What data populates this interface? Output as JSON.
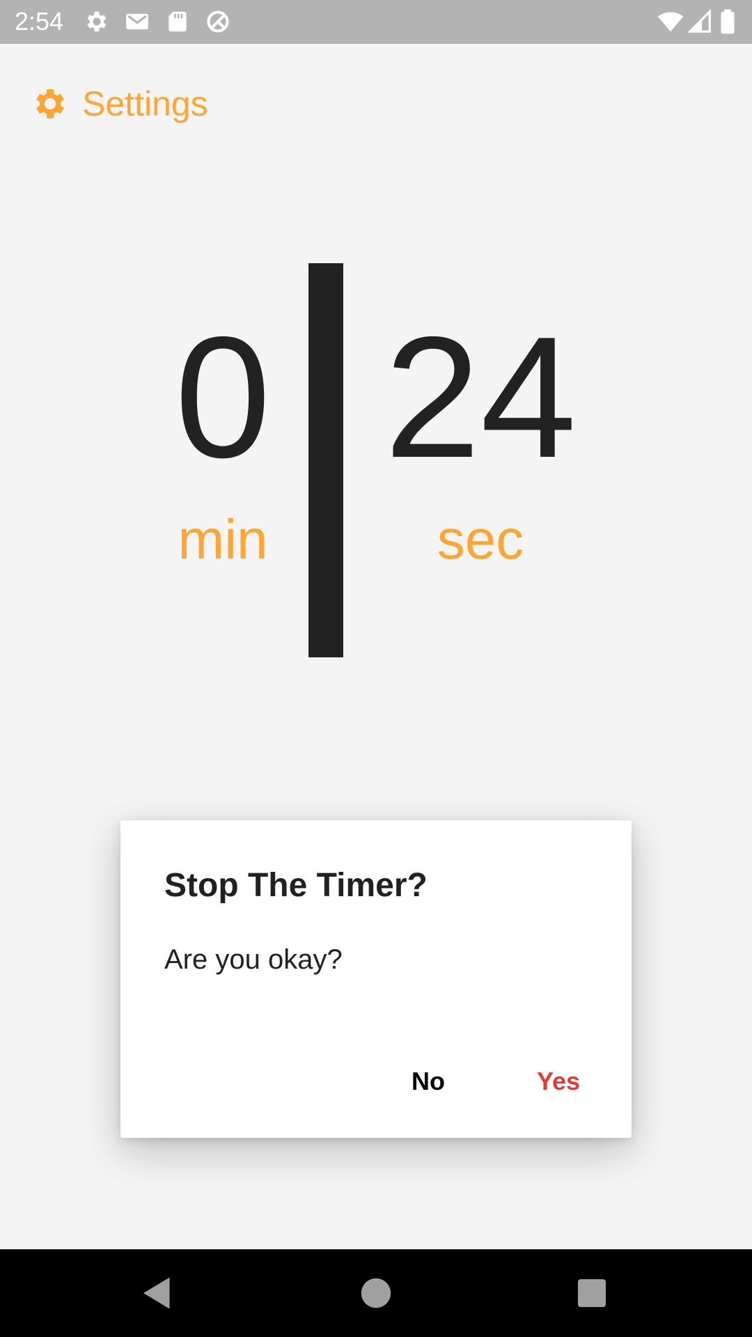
{
  "status_bar": {
    "time": "2:54",
    "icons_left": [
      "settings-icon",
      "gmail-icon",
      "sd-card-icon",
      "do-not-disturb-icon"
    ],
    "icons_right": [
      "wifi-icon",
      "cell-signal-icon",
      "battery-icon"
    ]
  },
  "header": {
    "settings_label": "Settings",
    "settings_icon": "gear-icon"
  },
  "timer": {
    "minutes": "0",
    "seconds": "24",
    "minutes_unit": "min",
    "seconds_unit": "sec"
  },
  "dialog": {
    "title": "Stop The Timer?",
    "message": "Are you okay?",
    "no_label": "No",
    "yes_label": "Yes"
  },
  "colors": {
    "accent": "#ffa534",
    "text_primary": "#222222",
    "danger": "#e53935",
    "status_bar": "#b3b3b3",
    "background": "#f4f4f4"
  },
  "nav_bar": {
    "buttons": [
      "back-icon",
      "home-icon",
      "recents-icon"
    ]
  }
}
